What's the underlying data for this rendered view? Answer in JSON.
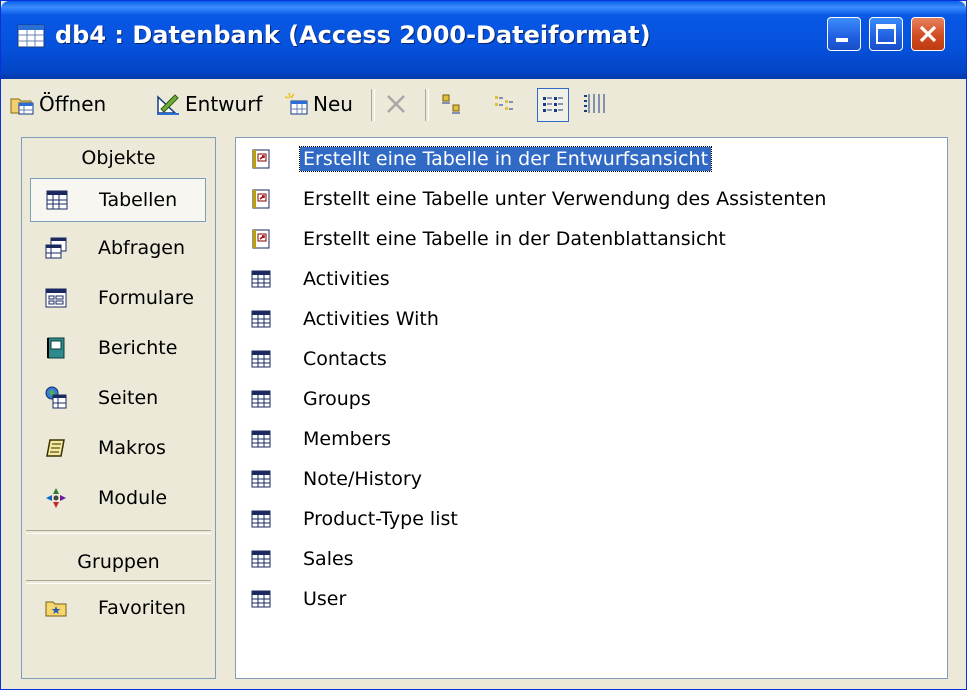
{
  "window": {
    "title": "db4 : Datenbank (Access 2000-Dateiformat)"
  },
  "toolbar": {
    "open_label": "Öffnen",
    "design_label": "Entwurf",
    "new_label": "Neu"
  },
  "sidebar": {
    "objects_header": "Objekte",
    "items": [
      {
        "label": "Tabellen",
        "icon": "table-icon",
        "selected": true
      },
      {
        "label": "Abfragen",
        "icon": "query-icon"
      },
      {
        "label": "Formulare",
        "icon": "form-icon"
      },
      {
        "label": "Berichte",
        "icon": "report-icon"
      },
      {
        "label": "Seiten",
        "icon": "page-icon"
      },
      {
        "label": "Makros",
        "icon": "macro-icon"
      },
      {
        "label": "Module",
        "icon": "module-icon"
      }
    ],
    "groups_header": "Gruppen",
    "groups": [
      {
        "label": "Favoriten",
        "icon": "favorites-folder-icon"
      }
    ]
  },
  "list": {
    "shortcuts": [
      {
        "label": "Erstellt eine Tabelle in der Entwurfsansicht",
        "icon": "shortcut-icon",
        "selected": true
      },
      {
        "label": "Erstellt eine Tabelle unter Verwendung des Assistenten",
        "icon": "shortcut-icon"
      },
      {
        "label": "Erstellt eine Tabelle in der Datenblattansicht",
        "icon": "shortcut-icon"
      }
    ],
    "tables": [
      {
        "label": "Activities"
      },
      {
        "label": "Activities With"
      },
      {
        "label": "Contacts"
      },
      {
        "label": "Groups"
      },
      {
        "label": "Members"
      },
      {
        "label": "Note/History"
      },
      {
        "label": "Product-Type list"
      },
      {
        "label": "Sales"
      },
      {
        "label": "User"
      }
    ]
  },
  "colors": {
    "title_bar": "#0551DB",
    "selection": "#316AC5",
    "close_button": "#D24C20",
    "face": "#ECE9D8"
  }
}
